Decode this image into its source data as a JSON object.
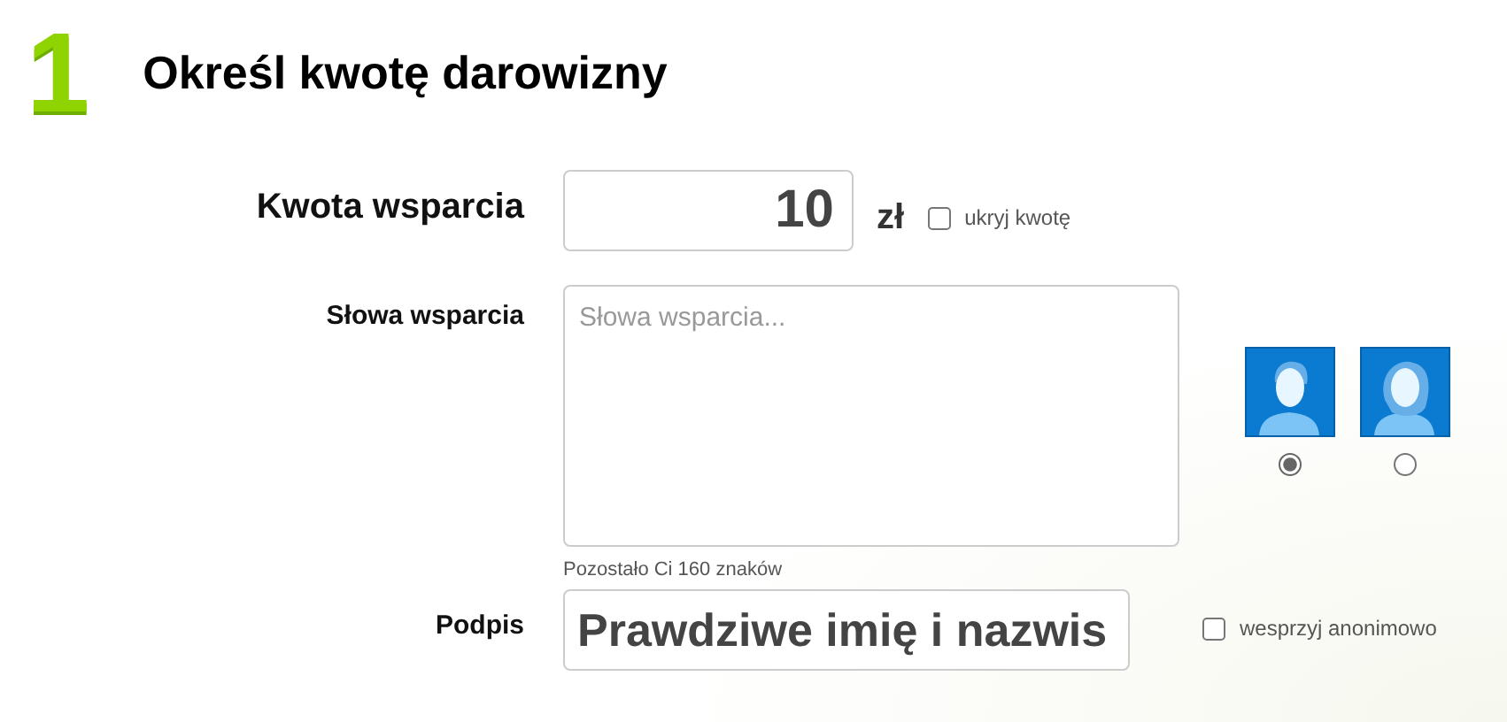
{
  "step": {
    "number": "1",
    "title": "Określ kwotę darowizny"
  },
  "amount": {
    "label": "Kwota wsparcia",
    "value": "10",
    "currency": "zł",
    "hide_amount": {
      "label": "ukryj kwotę",
      "checked": false
    }
  },
  "message": {
    "label": "Słowa wsparcia",
    "placeholder": "Słowa wsparcia...",
    "counter": "Pozostało Ci 160 znaków"
  },
  "avatars": [
    {
      "kind": "male",
      "selected": true
    },
    {
      "kind": "female",
      "selected": false
    }
  ],
  "signature": {
    "label": "Podpis",
    "value": "Prawdziwe imię i nazwis",
    "anonymous": {
      "label": "wesprzyj anonimowo",
      "checked": false
    }
  }
}
